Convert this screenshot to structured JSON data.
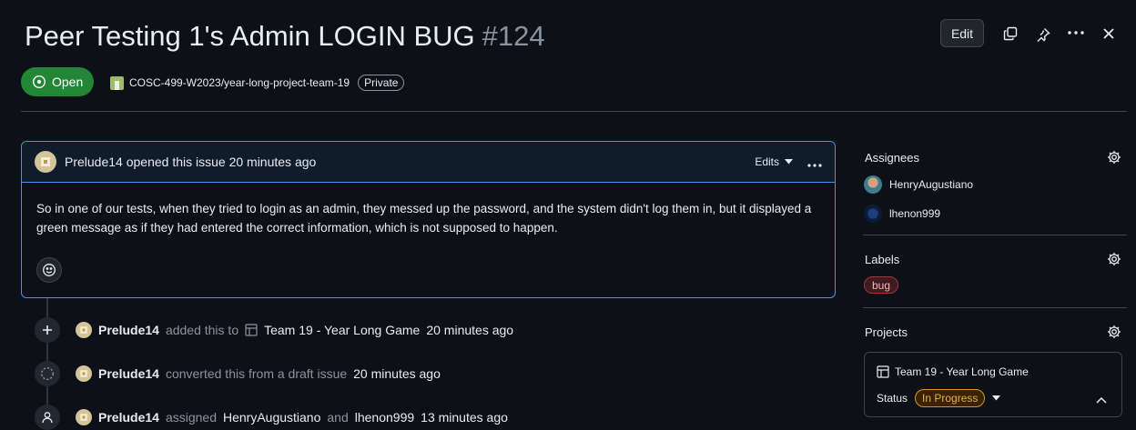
{
  "issue": {
    "title": "Peer Testing 1's Admin LOGIN BUG",
    "number": "#124",
    "state": "Open",
    "repo": "COSC-499-W2023/year-long-project-team-19",
    "visibility": "Private"
  },
  "header": {
    "edit_label": "Edit"
  },
  "comment": {
    "author": "Prelude14",
    "meta": "opened this issue 20 minutes ago",
    "edits_label": "Edits",
    "body": "So in one of our tests, when they tried to login as an admin, they messed up the password, and the system didn't log them in, but it displayed a green message as if they had entered the correct information, which is not supposed to happen."
  },
  "timeline": [
    {
      "actor": "Prelude14",
      "text_a": "added this to",
      "target": "Team 19 - Year Long Game",
      "time": "20 minutes ago"
    },
    {
      "actor": "Prelude14",
      "text_a": "converted this from a draft issue",
      "time": "20 minutes ago"
    },
    {
      "actor": "Prelude14",
      "text_a": "assigned",
      "target": "HenryAugustiano",
      "text_b": "and",
      "target2": "lhenon999",
      "time": "13 minutes ago"
    }
  ],
  "sidebar": {
    "assignees_heading": "Assignees",
    "assignees": [
      "HenryAugustiano",
      "lhenon999"
    ],
    "labels_heading": "Labels",
    "labels": [
      "bug"
    ],
    "projects_heading": "Projects",
    "project": {
      "name": "Team 19 - Year Long Game",
      "status_label": "Status",
      "status_value": "In Progress"
    }
  },
  "colors": {
    "background": "#0d1117",
    "open_green": "#238636",
    "accent_blue": "#4493f8",
    "status_yellow": "#d29922"
  }
}
